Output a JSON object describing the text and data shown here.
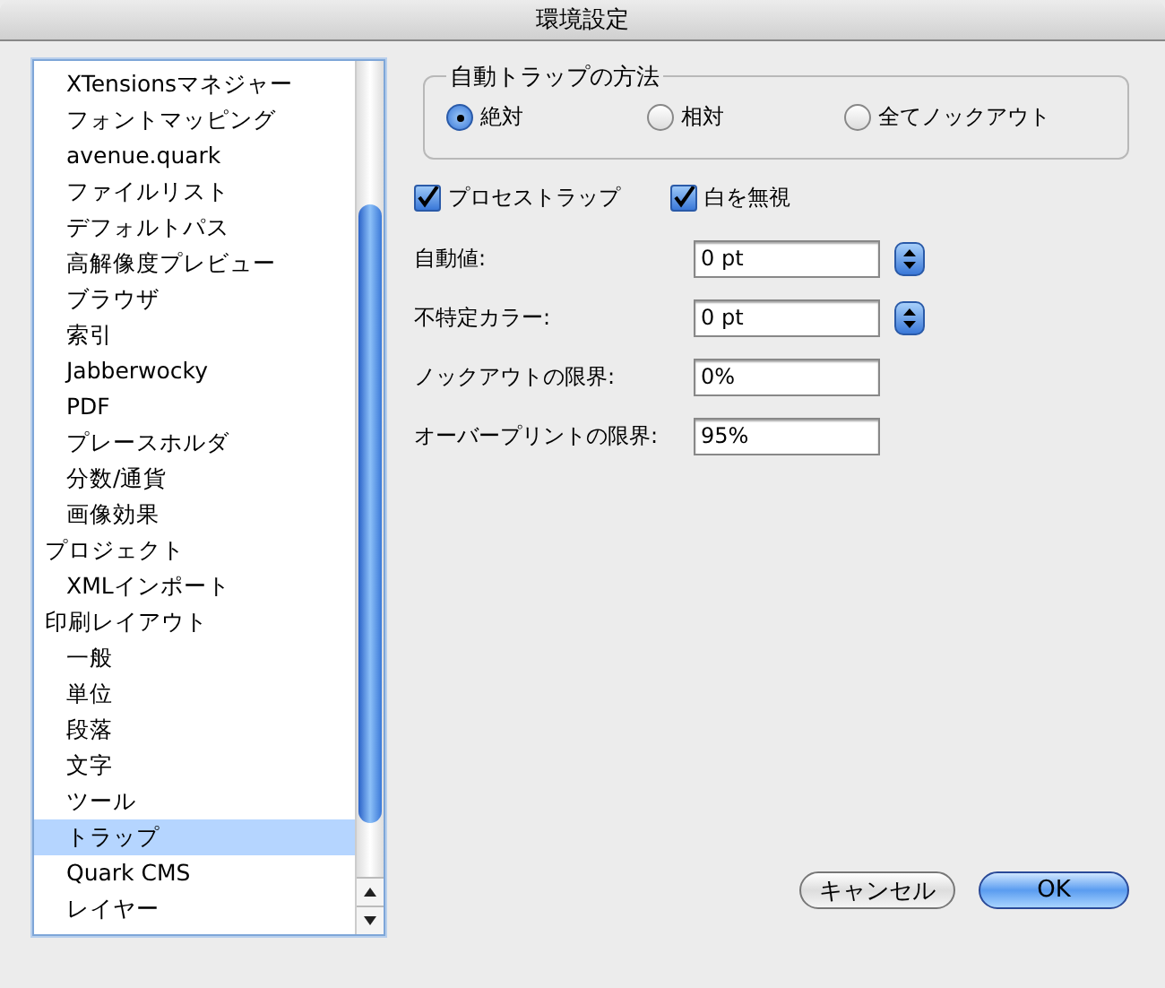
{
  "window": {
    "title": "環境設定"
  },
  "sidebar": {
    "items": [
      {
        "children": [
          {
            "label": "XTensionsマネジャー",
            "selected": false
          },
          {
            "label": "フォントマッピング",
            "selected": false
          },
          {
            "label": "avenue.quark",
            "selected": false
          },
          {
            "label": "ファイルリスト",
            "selected": false
          },
          {
            "label": "デフォルトパス",
            "selected": false
          },
          {
            "label": "高解像度プレビュー",
            "selected": false
          },
          {
            "label": "ブラウザ",
            "selected": false
          },
          {
            "label": "索引",
            "selected": false
          },
          {
            "label": "Jabberwocky",
            "selected": false
          },
          {
            "label": "PDF",
            "selected": false
          },
          {
            "label": "プレースホルダ",
            "selected": false
          },
          {
            "label": "分数/通貨",
            "selected": false
          },
          {
            "label": "画像効果",
            "selected": false
          }
        ]
      },
      {
        "label": "プロジェクト",
        "selected": false,
        "children": [
          {
            "label": "XMLインポート",
            "selected": false
          }
        ]
      },
      {
        "label": "印刷レイアウト",
        "selected": false,
        "children": [
          {
            "label": "一般",
            "selected": false
          },
          {
            "label": "単位",
            "selected": false
          },
          {
            "label": "段落",
            "selected": false
          },
          {
            "label": "文字",
            "selected": false
          },
          {
            "label": "ツール",
            "selected": false
          },
          {
            "label": "トラップ",
            "selected": true
          },
          {
            "label": "Quark CMS",
            "selected": false
          },
          {
            "label": "レイヤー",
            "selected": false
          }
        ]
      }
    ]
  },
  "trap_method": {
    "title": "自動トラップの方法",
    "options": [
      {
        "label": "絶対",
        "selected": true
      },
      {
        "label": "相対",
        "selected": false
      },
      {
        "label": "全てノックアウト",
        "selected": false
      }
    ]
  },
  "checkboxes": [
    {
      "label": "プロセストラップ",
      "checked": true
    },
    {
      "label": "白を無視",
      "checked": true
    }
  ],
  "fields": [
    {
      "label": "自動値:",
      "value": "0 pt",
      "kind": "stepper"
    },
    {
      "label": "不特定カラー:",
      "value": "0 pt",
      "kind": "stepper"
    },
    {
      "label": "ノックアウトの限界:",
      "value": "0%",
      "kind": "plain"
    },
    {
      "label": "オーバープリントの限界:",
      "value": "95%",
      "kind": "plain"
    }
  ],
  "buttons": [
    {
      "label": "キャンセル",
      "kind": "normal"
    },
    {
      "label": "OK",
      "kind": "default"
    }
  ]
}
